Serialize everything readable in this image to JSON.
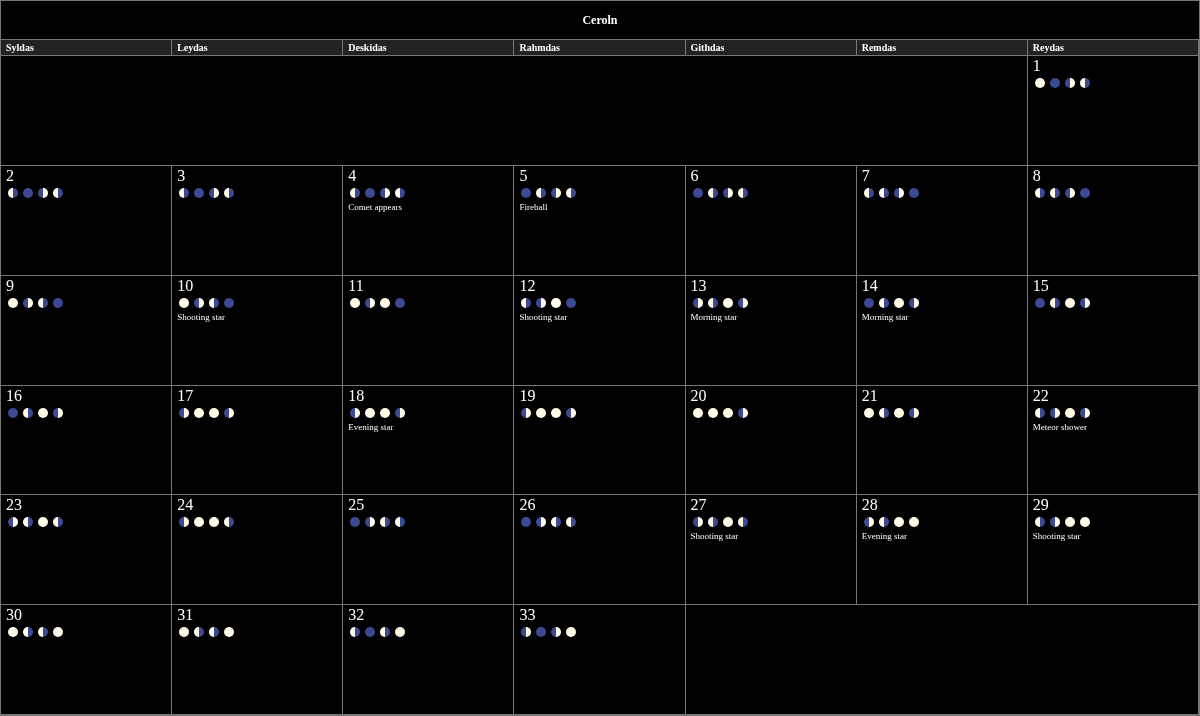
{
  "title": "Ceroln",
  "weekdays": [
    "Syldas",
    "Leydas",
    "Deskidas",
    "Rahmdas",
    "Githdas",
    "Remdas",
    "Reydas"
  ],
  "weeks": [
    [
      {
        "kind": "empty"
      },
      {
        "kind": "empty"
      },
      {
        "kind": "empty"
      },
      {
        "kind": "empty"
      },
      {
        "kind": "empty"
      },
      {
        "kind": "empty"
      },
      {
        "kind": "day",
        "day": "1",
        "moons": [
          {
            "kind": "full"
          },
          {
            "kind": "new"
          },
          {
            "kind": "first-quarter"
          },
          {
            "kind": "last-quarter"
          }
        ]
      }
    ],
    [
      {
        "kind": "day",
        "day": "2",
        "moons": [
          {
            "kind": "last-quarter"
          },
          {
            "kind": "new"
          },
          {
            "kind": "first-quarter"
          },
          {
            "kind": "last-quarter"
          }
        ]
      },
      {
        "kind": "day",
        "day": "3",
        "moons": [
          {
            "kind": "last-quarter"
          },
          {
            "kind": "new"
          },
          {
            "kind": "first-quarter"
          },
          {
            "kind": "last-quarter"
          }
        ]
      },
      {
        "kind": "day",
        "day": "4",
        "moons": [
          {
            "kind": "last-quarter"
          },
          {
            "kind": "new"
          },
          {
            "kind": "first-quarter"
          },
          {
            "kind": "last-quarter"
          }
        ],
        "event": "Comet appears"
      },
      {
        "kind": "day",
        "day": "5",
        "moons": [
          {
            "kind": "new"
          },
          {
            "kind": "last-quarter"
          },
          {
            "kind": "first-quarter"
          },
          {
            "kind": "last-quarter"
          }
        ],
        "event": "Fireball"
      },
      {
        "kind": "day",
        "day": "6",
        "moons": [
          {
            "kind": "new"
          },
          {
            "kind": "last-quarter"
          },
          {
            "kind": "first-quarter"
          },
          {
            "kind": "last-quarter"
          }
        ]
      },
      {
        "kind": "day",
        "day": "7",
        "moons": [
          {
            "kind": "last-quarter"
          },
          {
            "kind": "last-quarter"
          },
          {
            "kind": "first-quarter"
          },
          {
            "kind": "new"
          }
        ]
      },
      {
        "kind": "day",
        "day": "8",
        "moons": [
          {
            "kind": "last-quarter"
          },
          {
            "kind": "last-quarter"
          },
          {
            "kind": "first-quarter"
          },
          {
            "kind": "new"
          }
        ]
      }
    ],
    [
      {
        "kind": "day",
        "day": "9",
        "moons": [
          {
            "kind": "full"
          },
          {
            "kind": "first-quarter"
          },
          {
            "kind": "last-quarter"
          },
          {
            "kind": "new"
          }
        ]
      },
      {
        "kind": "day",
        "day": "10",
        "moons": [
          {
            "kind": "full"
          },
          {
            "kind": "first-quarter"
          },
          {
            "kind": "last-quarter"
          },
          {
            "kind": "new"
          }
        ],
        "event": "Shooting star"
      },
      {
        "kind": "day",
        "day": "11",
        "moons": [
          {
            "kind": "full"
          },
          {
            "kind": "first-quarter"
          },
          {
            "kind": "full"
          },
          {
            "kind": "new"
          }
        ]
      },
      {
        "kind": "day",
        "day": "12",
        "moons": [
          {
            "kind": "last-quarter"
          },
          {
            "kind": "first-quarter"
          },
          {
            "kind": "full"
          },
          {
            "kind": "new"
          }
        ],
        "event": "Shooting star"
      },
      {
        "kind": "day",
        "day": "13",
        "moons": [
          {
            "kind": "first-quarter"
          },
          {
            "kind": "last-quarter"
          },
          {
            "kind": "full"
          },
          {
            "kind": "first-quarter"
          }
        ],
        "event": "Morning star"
      },
      {
        "kind": "day",
        "day": "14",
        "moons": [
          {
            "kind": "new"
          },
          {
            "kind": "last-quarter"
          },
          {
            "kind": "full"
          },
          {
            "kind": "first-quarter"
          }
        ],
        "event": "Morning star"
      },
      {
        "kind": "day",
        "day": "15",
        "moons": [
          {
            "kind": "new"
          },
          {
            "kind": "last-quarter"
          },
          {
            "kind": "full"
          },
          {
            "kind": "first-quarter"
          }
        ]
      }
    ],
    [
      {
        "kind": "day",
        "day": "16",
        "moons": [
          {
            "kind": "new"
          },
          {
            "kind": "last-quarter"
          },
          {
            "kind": "full"
          },
          {
            "kind": "first-quarter"
          }
        ]
      },
      {
        "kind": "day",
        "day": "17",
        "moons": [
          {
            "kind": "first-quarter"
          },
          {
            "kind": "full"
          },
          {
            "kind": "full"
          },
          {
            "kind": "first-quarter"
          }
        ]
      },
      {
        "kind": "day",
        "day": "18",
        "moons": [
          {
            "kind": "first-quarter"
          },
          {
            "kind": "full"
          },
          {
            "kind": "full"
          },
          {
            "kind": "first-quarter"
          }
        ],
        "event": "Evening star"
      },
      {
        "kind": "day",
        "day": "19",
        "moons": [
          {
            "kind": "first-quarter"
          },
          {
            "kind": "full"
          },
          {
            "kind": "full"
          },
          {
            "kind": "first-quarter"
          }
        ]
      },
      {
        "kind": "day",
        "day": "20",
        "moons": [
          {
            "kind": "full"
          },
          {
            "kind": "full"
          },
          {
            "kind": "full"
          },
          {
            "kind": "first-quarter"
          }
        ]
      },
      {
        "kind": "day",
        "day": "21",
        "moons": [
          {
            "kind": "full"
          },
          {
            "kind": "last-quarter"
          },
          {
            "kind": "full"
          },
          {
            "kind": "first-quarter"
          }
        ]
      },
      {
        "kind": "day",
        "day": "22",
        "moons": [
          {
            "kind": "last-quarter"
          },
          {
            "kind": "first-quarter"
          },
          {
            "kind": "full"
          },
          {
            "kind": "first-quarter"
          }
        ],
        "event": "Meteor shower"
      }
    ],
    [
      {
        "kind": "day",
        "day": "23",
        "moons": [
          {
            "kind": "first-quarter"
          },
          {
            "kind": "last-quarter"
          },
          {
            "kind": "full"
          },
          {
            "kind": "last-quarter"
          }
        ]
      },
      {
        "kind": "day",
        "day": "24",
        "moons": [
          {
            "kind": "first-quarter"
          },
          {
            "kind": "full"
          },
          {
            "kind": "full"
          },
          {
            "kind": "last-quarter"
          }
        ]
      },
      {
        "kind": "day",
        "day": "25",
        "moons": [
          {
            "kind": "new"
          },
          {
            "kind": "first-quarter"
          },
          {
            "kind": "last-quarter"
          },
          {
            "kind": "last-quarter"
          }
        ]
      },
      {
        "kind": "day",
        "day": "26",
        "moons": [
          {
            "kind": "new"
          },
          {
            "kind": "first-quarter"
          },
          {
            "kind": "last-quarter"
          },
          {
            "kind": "last-quarter"
          }
        ]
      },
      {
        "kind": "day",
        "day": "27",
        "moons": [
          {
            "kind": "first-quarter"
          },
          {
            "kind": "last-quarter"
          },
          {
            "kind": "full"
          },
          {
            "kind": "last-quarter"
          }
        ],
        "event": "Shooting star"
      },
      {
        "kind": "day",
        "day": "28",
        "moons": [
          {
            "kind": "first-quarter"
          },
          {
            "kind": "last-quarter"
          },
          {
            "kind": "full"
          },
          {
            "kind": "full"
          }
        ],
        "event": "Evening star"
      },
      {
        "kind": "day",
        "day": "29",
        "moons": [
          {
            "kind": "last-quarter"
          },
          {
            "kind": "first-quarter"
          },
          {
            "kind": "full"
          },
          {
            "kind": "full"
          }
        ],
        "event": "Shooting star"
      }
    ],
    [
      {
        "kind": "day",
        "day": "30",
        "moons": [
          {
            "kind": "full"
          },
          {
            "kind": "last-quarter"
          },
          {
            "kind": "last-quarter"
          },
          {
            "kind": "full"
          }
        ]
      },
      {
        "kind": "day",
        "day": "31",
        "moons": [
          {
            "kind": "full"
          },
          {
            "kind": "last-quarter"
          },
          {
            "kind": "last-quarter"
          },
          {
            "kind": "full"
          }
        ]
      },
      {
        "kind": "day",
        "day": "32",
        "moons": [
          {
            "kind": "last-quarter"
          },
          {
            "kind": "new"
          },
          {
            "kind": "last-quarter"
          },
          {
            "kind": "full"
          }
        ]
      },
      {
        "kind": "day",
        "day": "33",
        "moons": [
          {
            "kind": "first-quarter"
          },
          {
            "kind": "new"
          },
          {
            "kind": "first-quarter"
          },
          {
            "kind": "full"
          }
        ]
      },
      {
        "kind": "empty"
      },
      {
        "kind": "empty"
      },
      {
        "kind": "empty"
      }
    ]
  ]
}
